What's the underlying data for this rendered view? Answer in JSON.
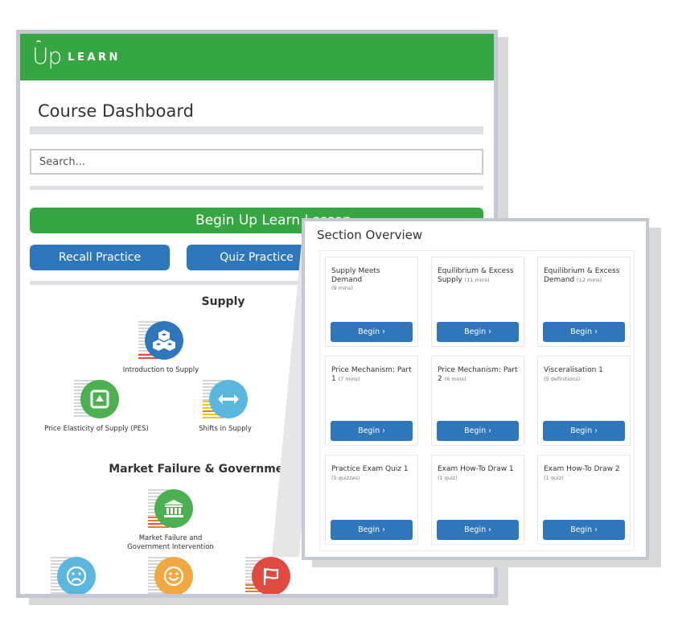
{
  "app": {
    "logo_up": "Up",
    "logo_learn": "LEARN",
    "brand_color": "#36a643",
    "accent_color": "#2f77bc"
  },
  "dashboard": {
    "title": "Course Dashboard",
    "search": {
      "placeholder": "Search...",
      "value": ""
    },
    "begin_lesson_label": "Begin Up Learn Lesson",
    "recall_practice_label": "Recall Practice",
    "quiz_practice_label": "Quiz Practice",
    "sections": [
      {
        "heading": "Supply",
        "topics": [
          {
            "label": "Introduction to Supply",
            "icon": "cubes-icon",
            "color": "#2f77bc",
            "progress_colors": [
              "#e74c3c"
            ],
            "progress": 0.15
          },
          {
            "label": "Price Elasticity of Supply (PES)",
            "icon": "triangle-box-icon",
            "color": "#4cb050",
            "progress_colors": [],
            "progress": 0
          },
          {
            "label": "Shifts in Supply",
            "icon": "double-arrow-icon",
            "color": "#5bb7dd",
            "progress_colors": [
              "#e67e22",
              "#f1c40f"
            ],
            "progress": 0.45
          }
        ]
      },
      {
        "heading": "Market Failure & Government Intervention",
        "topics": [
          {
            "label": "Market Failure and Government Intervention",
            "icon": "government-building-icon",
            "color": "#4cb050",
            "progress_colors": [
              "#e74c3c",
              "#e67e22"
            ],
            "progress": 0.3
          },
          {
            "label": "",
            "icon": "sad-face-icon",
            "color": "#5bb7dd",
            "progress_colors": [],
            "progress": 0
          },
          {
            "label": "",
            "icon": "happy-face-icon",
            "color": "#f0a840",
            "progress_colors": [],
            "progress": 0
          },
          {
            "label": "",
            "icon": "flag-icon",
            "color": "#e04b40",
            "progress_colors": [
              "#e67e22"
            ],
            "progress": 0.3
          }
        ]
      }
    ]
  },
  "overview": {
    "title": "Section Overview",
    "cards": [
      {
        "title": "Supply Meets Demand",
        "sub": "(9 mins)",
        "sub_inline": false,
        "button": "Begin ›"
      },
      {
        "title": "Equilibrium & Excess Supply",
        "sub": "(11 mins)",
        "sub_inline": true,
        "button": "Begin ›"
      },
      {
        "title": "Equilibrium & Excess Demand",
        "sub": "(12 mins)",
        "sub_inline": true,
        "button": "Begin ›"
      },
      {
        "title": "Price Mechanism: Part 1",
        "sub": "(7 mins)",
        "sub_inline": true,
        "button": "Begin ›"
      },
      {
        "title": "Price Mechanism: Part 2",
        "sub": "(6 mins)",
        "sub_inline": true,
        "button": "Begin ›"
      },
      {
        "title": "Visceralisation 1",
        "sub": "(5 definitions)",
        "sub_inline": false,
        "button": "Begin ›"
      },
      {
        "title": "Practice Exam Quiz 1",
        "sub": "(5 quizzes)",
        "sub_inline": false,
        "button": "Begin ›"
      },
      {
        "title": "Exam How-To Draw 1",
        "sub": "(1 quiz)",
        "sub_inline": false,
        "button": "Begin ›"
      },
      {
        "title": "Exam How-To Draw 2",
        "sub": "(1 quiz)",
        "sub_inline": false,
        "button": "Begin ›"
      }
    ]
  }
}
